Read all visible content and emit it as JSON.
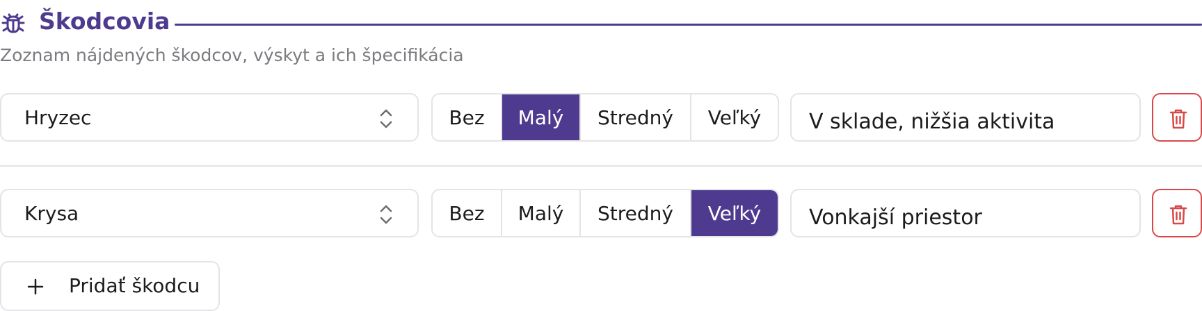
{
  "section": {
    "title": "Škodcovia",
    "subtitle": "Zoznam nájdených škodcov, výskyt a ich špecifikácia",
    "accent_color": "#4e3b8f",
    "icon": "bug-icon"
  },
  "severity_options": [
    "Bez",
    "Malý",
    "Stredný",
    "Veľký"
  ],
  "pests": [
    {
      "pest": "Hryzec",
      "severity": "Malý",
      "note": "V sklade, nižšia aktivita"
    },
    {
      "pest": "Krysa",
      "severity": "Veľký",
      "note": "Vonkajší priestor"
    }
  ],
  "add_button": {
    "label": "Pridať škodcu",
    "icon": "plus-icon"
  },
  "delete_button": {
    "icon": "trash-icon",
    "color": "#d94848"
  }
}
